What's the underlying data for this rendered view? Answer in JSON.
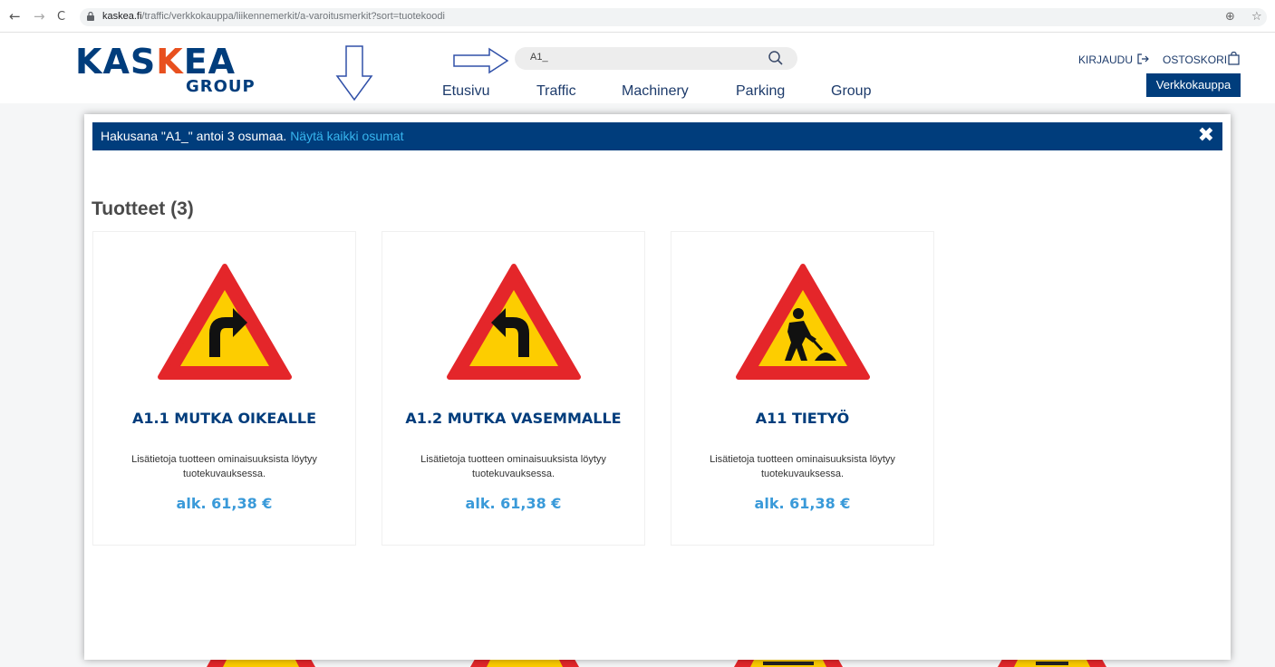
{
  "browser": {
    "url_host": "kaskea.fi",
    "url_path": "/traffic/verkkokauppa/liikennemerkit/a-varoitusmerkit?sort=tuotekoodi",
    "back": "←",
    "forward": "→",
    "reload": "C",
    "zoom": "⊕",
    "bookmark": "☆"
  },
  "header": {
    "logo_part1": "KAS",
    "logo_k": "K",
    "logo_part2": "EA",
    "logo_sub": "GROUP",
    "search_value": "A1_",
    "nav": [
      "Etusivu",
      "Traffic",
      "Machinery",
      "Parking",
      "Group"
    ],
    "login": "KIRJAUDU",
    "cart": "OSTOSKORI",
    "shop_button": "Verkkokauppa"
  },
  "search_results": {
    "summary": "Hakusana \"A1_\" antoi 3 osumaa.",
    "show_all": "Näytä kaikki osumat",
    "close": "✖",
    "section_title": "Tuotteet (3)",
    "products": [
      {
        "title": "A1.1 MUTKA OIKEALLE",
        "description": "Lisätietoja tuotteen ominaisuuksista löytyy tuotekuvauksessa.",
        "price": "alk. 61,38 €",
        "sign": "curve-right"
      },
      {
        "title": "A1.2 MUTKA VASEMMALLE",
        "description": "Lisätietoja tuotteen ominaisuuksista löytyy tuotekuvauksessa.",
        "price": "alk. 61,38 €",
        "sign": "curve-left"
      },
      {
        "title": "A11 TIETYÖ",
        "description": "Lisätietoja tuotteen ominaisuuksista löytyy tuotekuvauksessa.",
        "price": "alk. 61,38 €",
        "sign": "road-works"
      }
    ]
  },
  "colors": {
    "brand_blue": "#003d7c",
    "accent_orange": "#e8501f",
    "link_blue": "#37b5ee",
    "price_blue": "#3a9ad9",
    "sign_red": "#e4262a",
    "sign_yellow": "#fdcd00"
  }
}
